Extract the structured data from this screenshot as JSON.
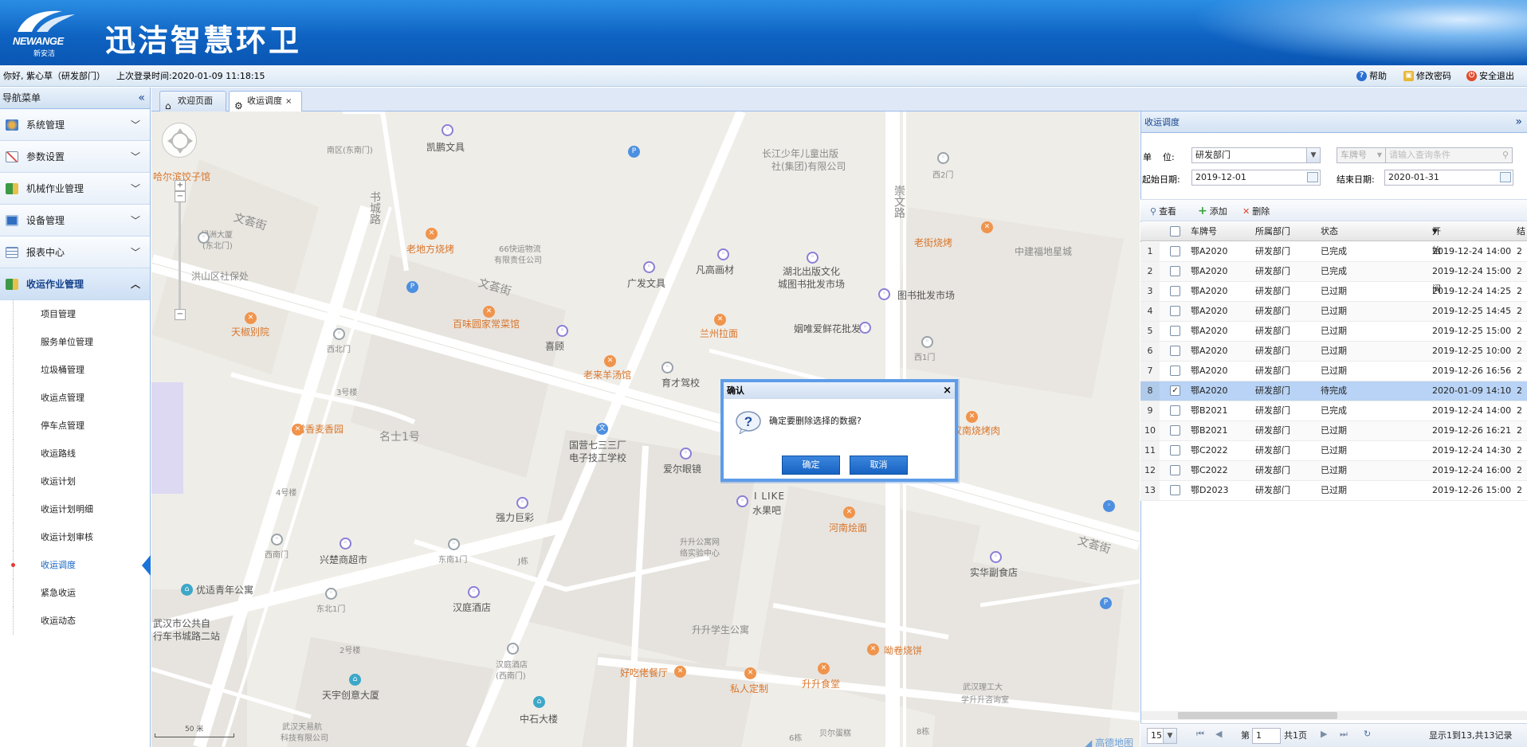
{
  "header": {
    "brand": "NEWANGE",
    "brand_cn": "新安洁",
    "title": "迅洁智慧环卫"
  },
  "infobar": {
    "welcome": "你好, 紫心草（研发部门）",
    "last_login_label": "上次登录时间:",
    "last_login_time": "2020-01-09 11:18:15",
    "help": "帮助",
    "change_password": "修改密码",
    "logout": "安全退出"
  },
  "sidebar": {
    "title": "导航菜单",
    "items": [
      {
        "label": "系统管理",
        "icon": "system-icon"
      },
      {
        "label": "参数设置",
        "icon": "chart-icon"
      },
      {
        "label": "机械作业管理",
        "icon": "truck-icon"
      },
      {
        "label": "设备管理",
        "icon": "monitor-icon"
      },
      {
        "label": "报表中心",
        "icon": "report-icon"
      },
      {
        "label": "收运作业管理",
        "icon": "garbage-truck-icon"
      }
    ],
    "sub_items": [
      "项目管理",
      "服务单位管理",
      "垃圾桶管理",
      "收运点管理",
      "停车点管理",
      "收运路线",
      "收运计划",
      "收运计划明细",
      "收运计划审核",
      "收运调度",
      "紧急收运",
      "收运动态"
    ]
  },
  "tabs": [
    {
      "label": "欢迎页面",
      "icon": "home-icon"
    },
    {
      "label": "收运调度",
      "icon": "dispatch-icon",
      "close": "×"
    }
  ],
  "map": {
    "scale": "50 米",
    "attribution": "高德地图",
    "labels": [
      "凯鹏文具",
      "南区(东南门)",
      "长江少年儿童出版",
      "社(集团)有限公司",
      "西2门",
      "哈尔滨饺子馆",
      "文荟街",
      "书城路",
      "绿洲大厦",
      "(东北门)",
      "老地方烧烤",
      "66快运物流",
      "有限责任公司",
      "凡高画材",
      "湖北出版文化",
      "城图书批发市场",
      "崇文路",
      "老街烧烤",
      "中建福地星城",
      "洪山区社保处",
      "广发文具",
      "图书批发市场",
      "文荟街",
      "百味圆家常菜馆",
      "兰州拉面",
      "姻唯爱鲜花批发",
      "天椒别院",
      "西北门",
      "喜顾",
      "老来羊汤馆",
      "育才驾校",
      "西1门",
      "3号楼",
      "常香麦香园",
      "名士1号",
      "武汉市公共自",
      "行车书城路二站",
      "国营七三三厂",
      "电子技工学校",
      "爱尔眼镜",
      "汉南烧烤肉",
      "强力巨彩",
      "I LIKE",
      "水果吧",
      "河南烩面",
      "4号楼",
      "西南门",
      "兴楚商超市",
      "东南1门",
      "升升公寓网",
      "络实验中心",
      "文荟街",
      "优适青年公寓",
      "东北1门",
      "汉庭酒店",
      "实华副食店",
      "升升学生公寓",
      "2号楼",
      "汉庭酒店",
      "(西南门)",
      "好吃佬餐厅",
      "私人定制",
      "升升食堂",
      "呦卷烧饼",
      "武汉理工大",
      "学升升咨询室",
      "天宇创意大厦",
      "中石大楼",
      "武汉天易航",
      "科技有限公司",
      "贝尔蛋糕",
      "J栋",
      "8栋",
      "6栋"
    ]
  },
  "panel": {
    "title": "收运调度",
    "unit_label": "单    位:",
    "unit_value": "研发部门",
    "plate_select": "车牌号",
    "search_placeholder": "请输入查询条件",
    "start_label": "起始日期:",
    "start_value": "2019-12-01",
    "end_label": "结束日期:",
    "end_value": "2020-01-31",
    "toolbar": {
      "view": "查看",
      "add": "添加",
      "delete": "删除"
    },
    "columns": [
      "车牌号",
      "所属部门",
      "状态",
      "开始时间",
      "结"
    ],
    "rows": [
      {
        "n": "1",
        "plate": "鄂A2020",
        "dept": "研发部门",
        "status": "已完成",
        "start": "2019-12-24 14:00",
        "end": "2",
        "checked": false
      },
      {
        "n": "2",
        "plate": "鄂A2020",
        "dept": "研发部门",
        "status": "已完成",
        "start": "2019-12-24 15:00",
        "end": "2",
        "checked": false
      },
      {
        "n": "3",
        "plate": "鄂A2020",
        "dept": "研发部门",
        "status": "已过期",
        "start": "2019-12-24 14:25",
        "end": "2",
        "checked": false
      },
      {
        "n": "4",
        "plate": "鄂A2020",
        "dept": "研发部门",
        "status": "已过期",
        "start": "2019-12-25 14:45",
        "end": "2",
        "checked": false
      },
      {
        "n": "5",
        "plate": "鄂A2020",
        "dept": "研发部门",
        "status": "已过期",
        "start": "2019-12-25 15:00",
        "end": "2",
        "checked": false
      },
      {
        "n": "6",
        "plate": "鄂A2020",
        "dept": "研发部门",
        "status": "已过期",
        "start": "2019-12-25 10:00",
        "end": "2",
        "checked": false
      },
      {
        "n": "7",
        "plate": "鄂A2020",
        "dept": "研发部门",
        "status": "已过期",
        "start": "2019-12-26 16:56",
        "end": "2",
        "checked": false
      },
      {
        "n": "8",
        "plate": "鄂A2020",
        "dept": "研发部门",
        "status": "待完成",
        "start": "2020-01-09 14:10",
        "end": "2",
        "checked": true
      },
      {
        "n": "9",
        "plate": "鄂B2021",
        "dept": "研发部门",
        "status": "已完成",
        "start": "2019-12-24 14:00",
        "end": "2",
        "checked": false
      },
      {
        "n": "10",
        "plate": "鄂B2021",
        "dept": "研发部门",
        "status": "已过期",
        "start": "2019-12-26 16:21",
        "end": "2",
        "checked": false
      },
      {
        "n": "11",
        "plate": "鄂C2022",
        "dept": "研发部门",
        "status": "已过期",
        "start": "2019-12-24 14:30",
        "end": "2",
        "checked": false
      },
      {
        "n": "12",
        "plate": "鄂C2022",
        "dept": "研发部门",
        "status": "已过期",
        "start": "2019-12-24 16:00",
        "end": "2",
        "checked": false
      },
      {
        "n": "13",
        "plate": "鄂D2023",
        "dept": "研发部门",
        "status": "已过期",
        "start": "2019-12-26 15:00",
        "end": "2",
        "checked": false
      }
    ],
    "pager": {
      "page_size": "15",
      "page_prefix": "第",
      "page_value": "1",
      "page_suffix": "共1页",
      "summary": "显示1到13,共13记录"
    }
  },
  "dialog": {
    "title": "确认",
    "close": "×",
    "message": "确定要删除选择的数据?",
    "ok": "确定",
    "cancel": "取消"
  }
}
